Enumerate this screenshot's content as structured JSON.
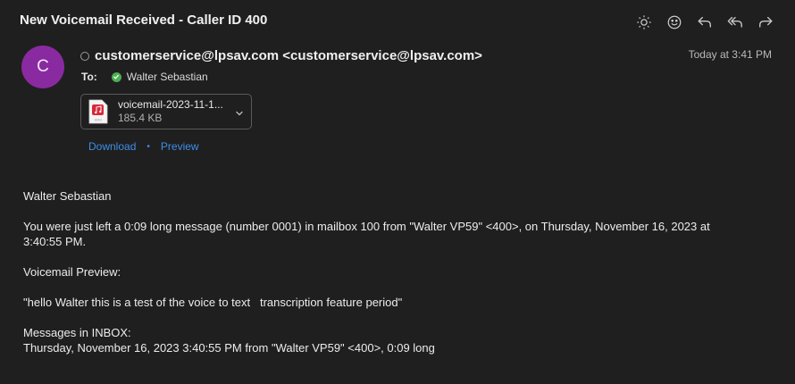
{
  "email": {
    "subject": "New Voicemail Received - Caller ID 400",
    "avatar_initial": "C",
    "from": "customerservice@lpsav.com <customerservice@lpsav.com>",
    "date": "Today at 3:41 PM",
    "to_label": "To:",
    "to_name": "Walter Sebastian"
  },
  "toolbar": {
    "icons": [
      "brightness-icon",
      "emoji-icon",
      "reply-icon",
      "reply-all-icon",
      "forward-icon"
    ]
  },
  "attachment": {
    "name": "voicemail-2023-11-1...",
    "size": "185.4 KB",
    "file_badge": "WAV",
    "download_label": "Download",
    "separator": "•",
    "preview_label": "Preview"
  },
  "body": {
    "greeting": "Walter Sebastian",
    "message": "You were just left a 0:09 long message (number 0001) in mailbox 100 from \"Walter VP59\" <400>, on Thursday, November 16, 2023 at 3:40:55 PM.",
    "preview_heading": "Voicemail Preview:",
    "transcript": "\"hello Walter this is a test of the voice to text   transcription feature period\"",
    "inbox_heading": "Messages in INBOX:",
    "inbox_entry": "Thursday, November 16, 2023 3:40:55 PM from \"Walter VP59\" <400>, 0:09 long"
  },
  "colors": {
    "background": "#1f1f1f",
    "avatar": "#8a2aa0",
    "link": "#3e8ee8",
    "verified": "#4caf50",
    "file_icon": "#d8293a"
  }
}
